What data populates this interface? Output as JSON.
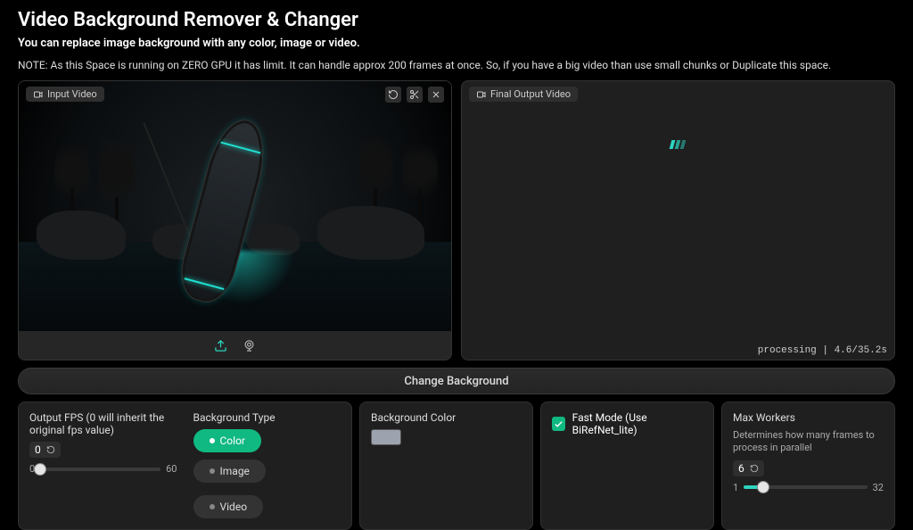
{
  "header": {
    "title": "Video Background Remover & Changer",
    "subtitle": "You can replace image background with any color, image or video.",
    "note": "NOTE: As this Space is running on ZERO GPU it has limit. It can handle approx 200 frames at once. So, if you have a big video than use small chunks or Duplicate this space."
  },
  "input_panel": {
    "label": "Input Video"
  },
  "output_panel": {
    "label": "Final Output Video",
    "status_text": "processing | 4.6/35.2s"
  },
  "accordion": {
    "title": "Change Background"
  },
  "fps": {
    "label": "Output FPS (0 will inherit the original fps value)",
    "value": "0",
    "min": "0",
    "max": "60"
  },
  "bgtype": {
    "label": "Background Type",
    "options": {
      "color": "Color",
      "image": "Image",
      "video": "Video"
    },
    "selected": "color"
  },
  "bgcolor": {
    "label": "Background Color",
    "value": "#9ca3af"
  },
  "fastmode": {
    "label": "Fast Mode (Use BiRefNet_lite)",
    "checked": true
  },
  "workers": {
    "label": "Max Workers",
    "hint": "Determines how many frames to process in parallel",
    "value": "6",
    "min": "1",
    "max": "32"
  }
}
